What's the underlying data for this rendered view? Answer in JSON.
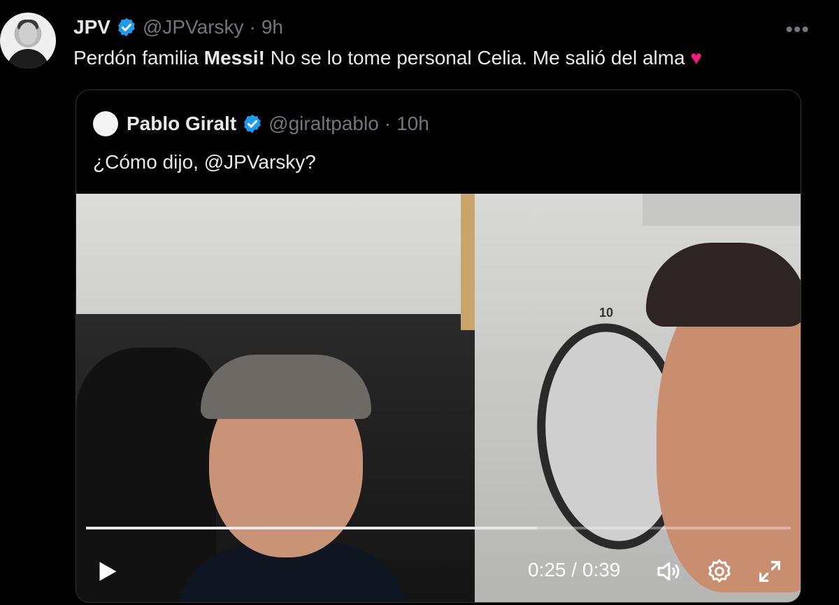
{
  "author": {
    "name": "JPV",
    "handle": "@JPVarsky",
    "dot": "·",
    "time": "9h"
  },
  "tweet": {
    "text_before": "Perdón familia ",
    "text_bold": "Messi!",
    "text_after": " No se lo tome personal Celia. Me salió del alma ",
    "heart": "♥"
  },
  "more_icon": "•••",
  "quote": {
    "name": "Pablo Giralt",
    "handle": "@giraltpablo",
    "dot": "·",
    "time": "10h",
    "text": "¿Cómo dijo, @JPVarsky?"
  },
  "video": {
    "door_number": "10",
    "current_time": "0:25",
    "separator": "/",
    "duration": "0:39",
    "progress": 0.64
  },
  "icons": {
    "play": "play-icon",
    "volume": "volume-icon",
    "settings": "gear-icon",
    "fullscreen": "fullscreen-icon",
    "verified": "verified-badge-icon"
  },
  "colors": {
    "verified_blue": "#1d9bf0",
    "muted_text": "#71767b",
    "heart": "#f91880"
  }
}
